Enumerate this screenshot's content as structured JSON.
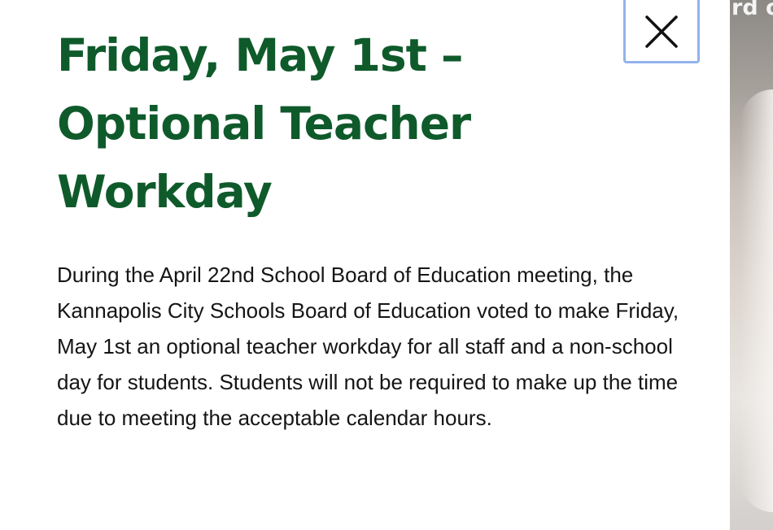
{
  "announcement": {
    "title": "Friday, May 1st – Optional Teacher Workday",
    "body": "During the April 22nd School Board of Education meeting, the Kannapolis City Schools Board of Education voted to make Friday, May 1st an optional teacher workday for all staff and a non-school day for students. Students will not be required to make up the time due to meeting the acceptable calendar hours.",
    "close_icon": "close-icon"
  },
  "background": {
    "visible_text": "rd o"
  },
  "colors": {
    "title": "#0f5a2b",
    "body_text": "#151515",
    "close_border": "#93b3ec"
  }
}
